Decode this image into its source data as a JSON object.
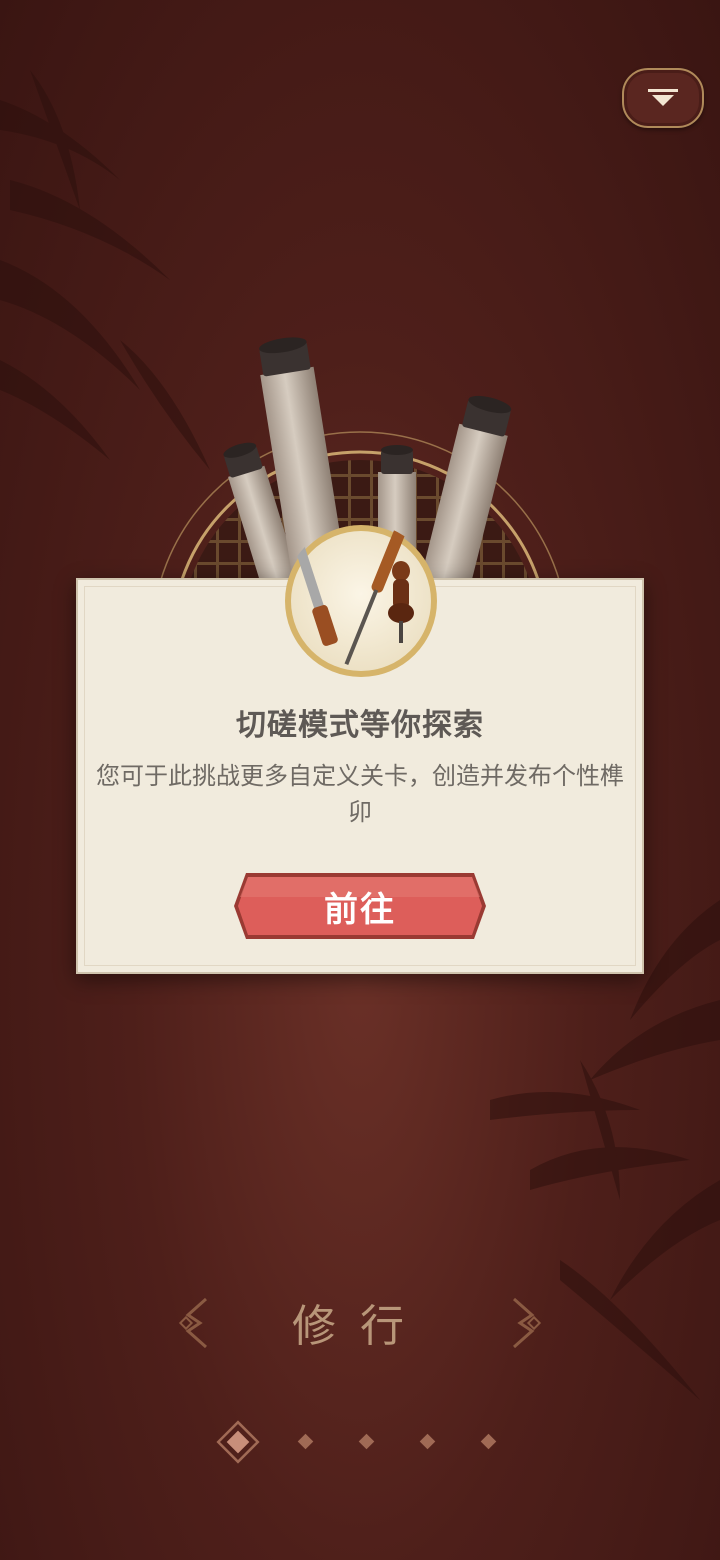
{
  "dialog": {
    "title": "切磋模式等你探索",
    "description": "您可于此挑战更多自定义关卡，创造并发布个性榫卯",
    "go_label": "前往"
  },
  "section": {
    "title": "修行"
  },
  "pagination": {
    "total": 5,
    "active": 1
  },
  "colors": {
    "background": "#4e1f1a",
    "card": "#f1ebdd",
    "button": "#d95a57",
    "accent_gold": "#b08a5a"
  },
  "icons": {
    "corner": "chevron-down-icon",
    "medal": "carving-tools-icon",
    "ornament": "lattice-ornament-icon"
  }
}
